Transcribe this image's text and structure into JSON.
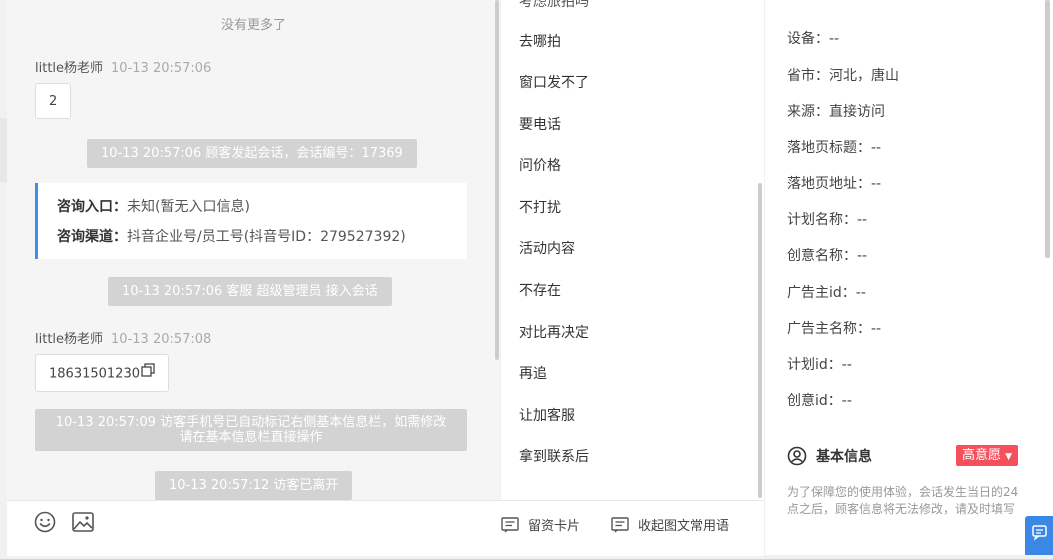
{
  "chat": {
    "no_more": "没有更多了",
    "messages": [
      {
        "sender": "little杨老师",
        "time": "10-13 20:57:06",
        "text": "2"
      },
      {
        "sender": "little杨老师",
        "time": "10-13 20:57:08",
        "text": "18631501230"
      }
    ],
    "system": [
      "10-13 20:57:06 顾客发起会话，会话编号：17369",
      "10-13 20:57:06 客服 超级管理员 接入会话",
      "10-13 20:57:09 访客手机号已自动标记右侧基本信息栏，如需修改请在基本信息栏直接操作",
      "10-13 20:57:12 访客已离开"
    ],
    "card": {
      "entry_label": "咨询入口：",
      "entry_value": "未知(暂无入口信息)",
      "channel_label": "咨询渠道：",
      "channel_value": "抖音企业号/员工号(抖音号ID：279527392)"
    }
  },
  "composer": {
    "lead_card": "留资卡片",
    "collapse_phrases": "收起图文常用语"
  },
  "phrases": [
    "去哪拍",
    "窗口发不了",
    "要电话",
    "问价格",
    "不打扰",
    "活动内容",
    "不存在",
    "对比再决定",
    "再追",
    "让加客服",
    "拿到联系后"
  ],
  "info": {
    "fields": [
      {
        "label": "设备：",
        "value": "--"
      },
      {
        "label": "省市：",
        "value": "河北，唐山"
      },
      {
        "label": "来源：",
        "value": "直接访问"
      },
      {
        "label": "落地页标题：",
        "value": "--"
      },
      {
        "label": "落地页地址：",
        "value": "--"
      },
      {
        "label": "计划名称：",
        "value": "--"
      },
      {
        "label": "创意名称：",
        "value": "--"
      },
      {
        "label": "广告主id：",
        "value": "--"
      },
      {
        "label": "广告主名称：",
        "value": "--"
      },
      {
        "label": "计划id：",
        "value": "--"
      },
      {
        "label": "创意id：",
        "value": "--"
      }
    ],
    "basic_title": "基本信息",
    "intent": "高意愿",
    "note": "为了保障您的使用体验，会话发生当日的24点之后，顾客信息将无法修改，请及时填写"
  },
  "colors": {
    "accent": "#3a87e6",
    "intent_badge": "#f4515c",
    "system_msg": "#d3d3d3"
  }
}
